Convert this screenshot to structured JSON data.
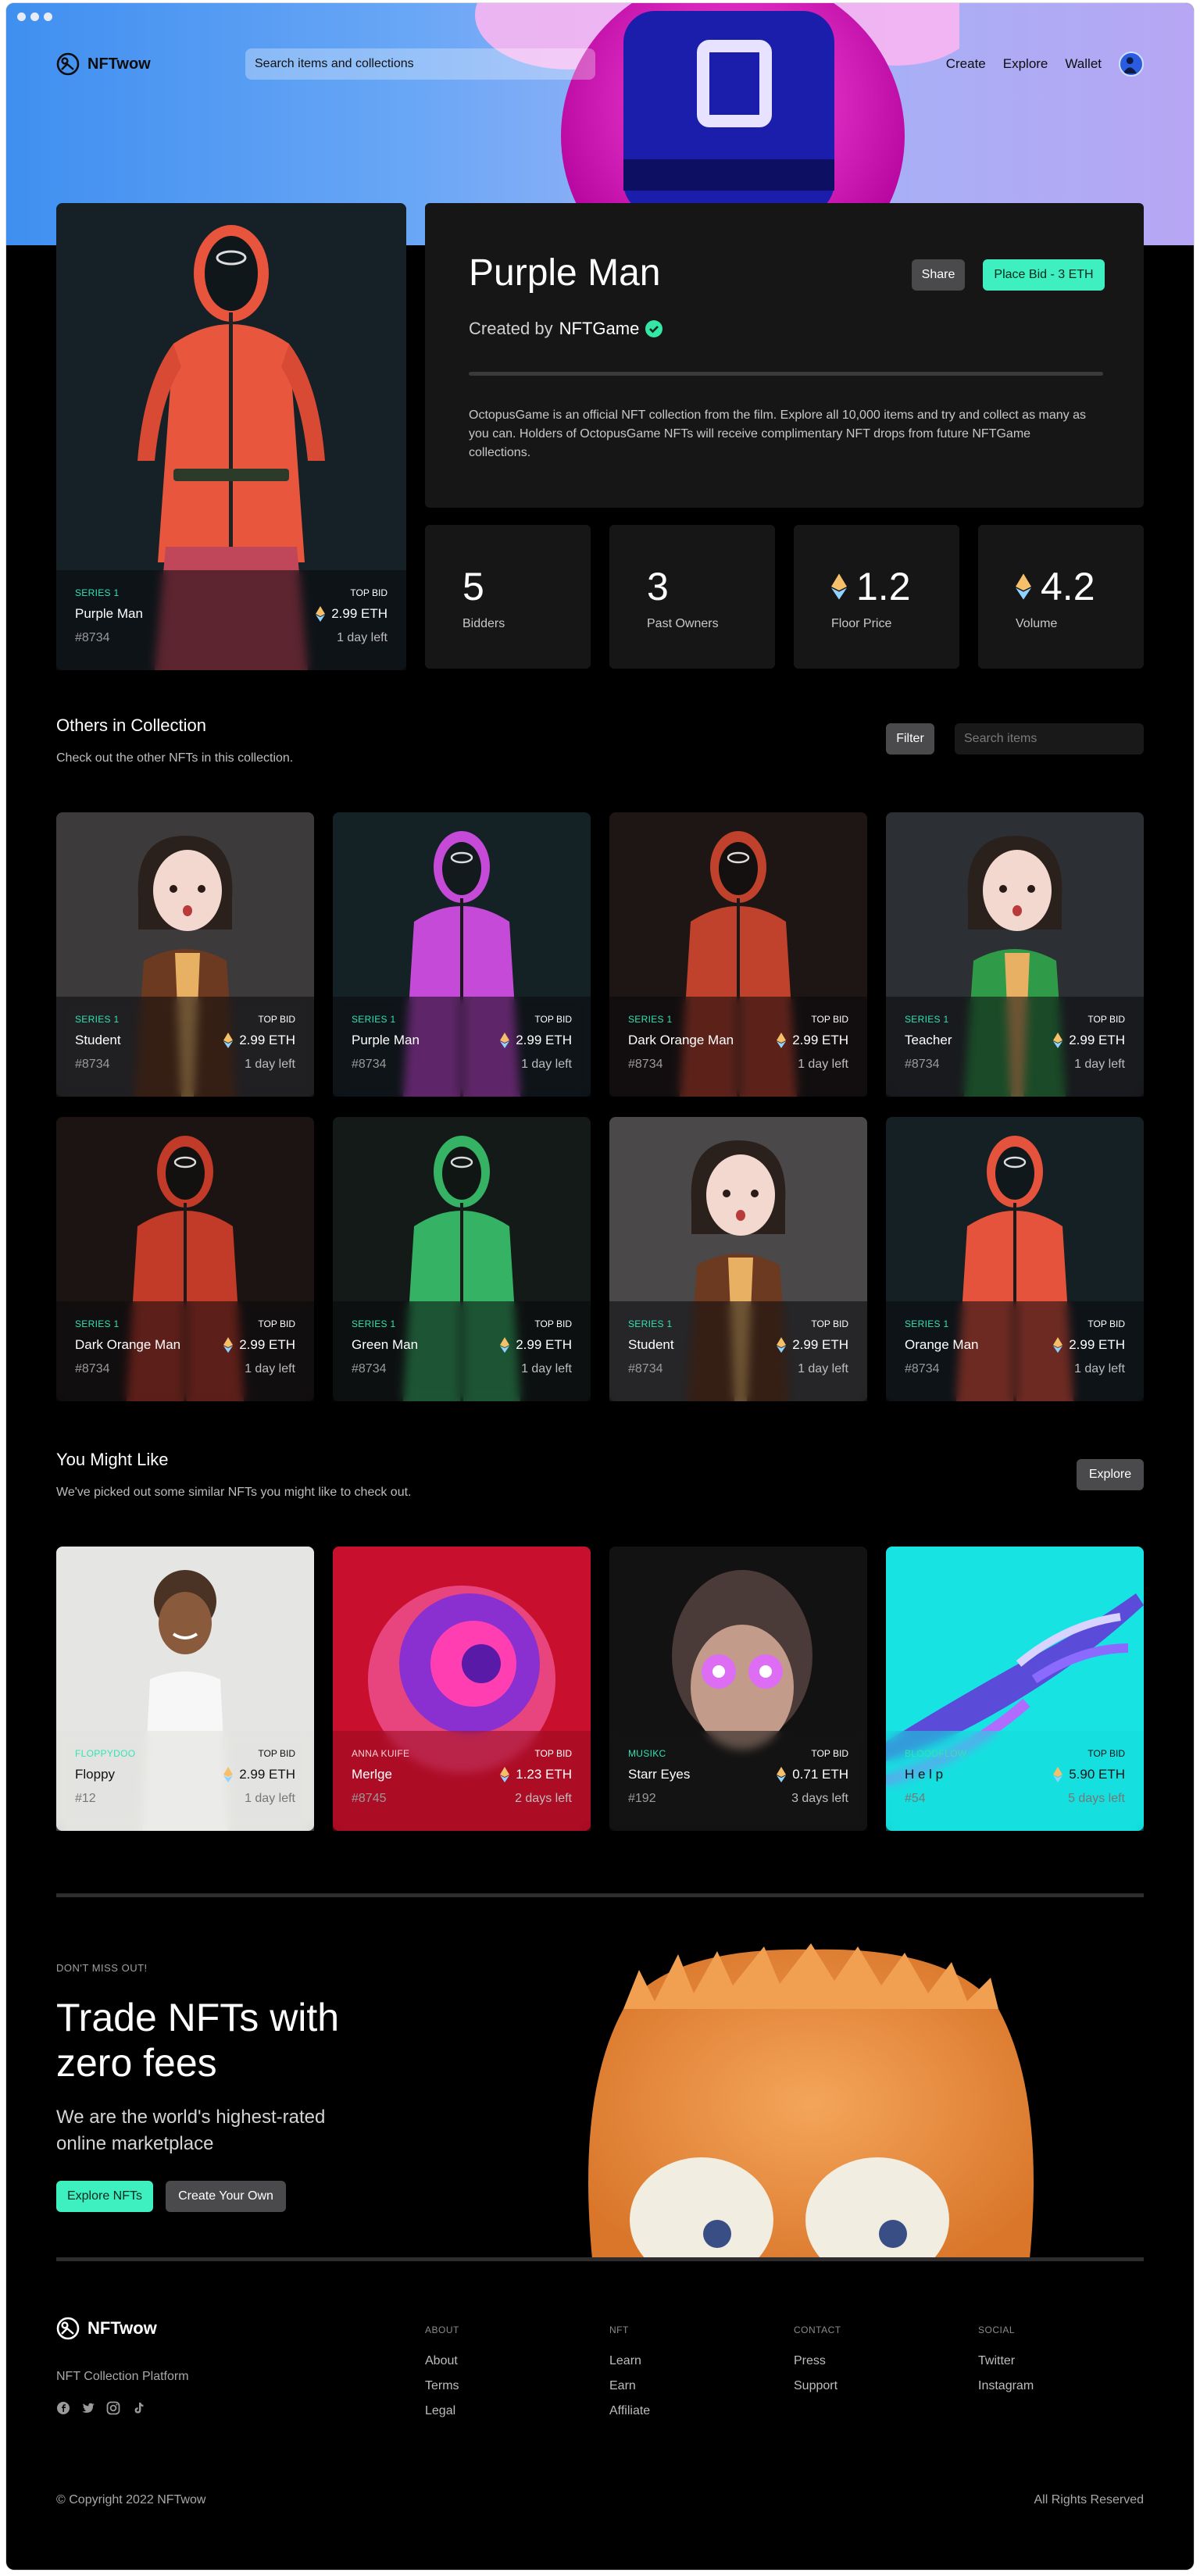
{
  "brand": {
    "name": "NFTwow",
    "tagline": "NFT Collection Platform"
  },
  "nav": {
    "search_placeholder": "Search items and collections",
    "links": [
      "Create",
      "Explore",
      "Wallet"
    ]
  },
  "featured": {
    "series": "SERIES 1",
    "top_bid_label": "TOP BID",
    "name": "Purple Man",
    "price": "2.99 ETH",
    "id": "#8734",
    "time_left": "1 day left"
  },
  "detail": {
    "title": "Purple Man",
    "created_by_prefix": "Created by",
    "creator": "NFTGame",
    "share_label": "Share",
    "bid_label": "Place Bid - 3 ETH",
    "description": "OctopusGame is an official NFT collection from the film. Explore all 10,000 items and try and collect as many as you can. Holders of OctopusGame NFTs will receive complimentary NFT drops from future NFTGame collections."
  },
  "stats": [
    {
      "value": "5",
      "label": "Bidders",
      "eth": false
    },
    {
      "value": "3",
      "label": "Past Owners",
      "eth": false
    },
    {
      "value": "1.2",
      "label": "Floor Price",
      "eth": true
    },
    {
      "value": "4.2",
      "label": "Volume",
      "eth": true
    }
  ],
  "collection": {
    "title": "Others in Collection",
    "subtitle": "Check out the other NFTs in this collection.",
    "filter_label": "Filter",
    "search_placeholder": "Search items",
    "items": [
      {
        "series": "SERIES 1",
        "top_bid": "TOP BID",
        "name": "Student",
        "price": "2.99 ETH",
        "id": "#8734",
        "time": "1 day left"
      },
      {
        "series": "SERIES 1",
        "top_bid": "TOP BID",
        "name": "Purple Man",
        "price": "2.99 ETH",
        "id": "#8734",
        "time": "1 day left"
      },
      {
        "series": "SERIES 1",
        "top_bid": "TOP BID",
        "name": "Dark Orange Man",
        "price": "2.99 ETH",
        "id": "#8734",
        "time": "1 day left"
      },
      {
        "series": "SERIES 1",
        "top_bid": "TOP BID",
        "name": "Teacher",
        "price": "2.99 ETH",
        "id": "#8734",
        "time": "1 day left"
      },
      {
        "series": "SERIES 1",
        "top_bid": "TOP BID",
        "name": "Dark Orange Man",
        "price": "2.99 ETH",
        "id": "#8734",
        "time": "1 day left"
      },
      {
        "series": "SERIES 1",
        "top_bid": "TOP BID",
        "name": "Green Man",
        "price": "2.99 ETH",
        "id": "#8734",
        "time": "1 day left"
      },
      {
        "series": "SERIES 1",
        "top_bid": "TOP BID",
        "name": "Student",
        "price": "2.99 ETH",
        "id": "#8734",
        "time": "1 day left"
      },
      {
        "series": "SERIES 1",
        "top_bid": "TOP BID",
        "name": "Orange Man",
        "price": "2.99 ETH",
        "id": "#8734",
        "time": "1 day left"
      }
    ]
  },
  "suggest": {
    "title": "You Might Like",
    "subtitle": "We've picked out some similar NFTs you might like to check out.",
    "explore_label": "Explore",
    "items": [
      {
        "series": "FLOPPYDOO",
        "top_bid": "TOP BID",
        "name": "Floppy",
        "price": "2.99 ETH",
        "id": "#12",
        "time": "1 day left"
      },
      {
        "series": "ANNA KUIFE",
        "top_bid": "TOP BID",
        "name": "Merlge",
        "price": "1.23 ETH",
        "id": "#8745",
        "time": "2 days left"
      },
      {
        "series": "MUSIKC",
        "top_bid": "TOP BID",
        "name": "Starr Eyes",
        "price": "0.71 ETH",
        "id": "#192",
        "time": "3 days left"
      },
      {
        "series": "BLOODFLOW",
        "top_bid": "TOP BID",
        "name": "H e l p",
        "price": "5.90 ETH",
        "id": "#54",
        "time": "5 days left"
      }
    ]
  },
  "promo": {
    "eyebrow": "DON'T MISS OUT!",
    "title": "Trade NFTs with zero fees",
    "subtitle": "We are the world's highest-rated online marketplace",
    "primary": "Explore NFTs",
    "secondary": "Create Your Own"
  },
  "footer": {
    "columns": [
      {
        "head": "ABOUT",
        "links": [
          "About",
          "Terms",
          "Legal"
        ]
      },
      {
        "head": "NFT",
        "links": [
          "Learn",
          "Earn",
          "Affiliate"
        ]
      },
      {
        "head": "CONTACT",
        "links": [
          "Press",
          "Support"
        ]
      },
      {
        "head": "SOCIAL",
        "links": [
          "Twitter",
          "Instagram"
        ]
      }
    ],
    "copyright": "© Copyright 2022 NFTwow",
    "rights": "All Rights Reserved"
  },
  "colors": {
    "accent": "#3ef0bf",
    "series": "#34e3b0",
    "panel": "#161617"
  }
}
